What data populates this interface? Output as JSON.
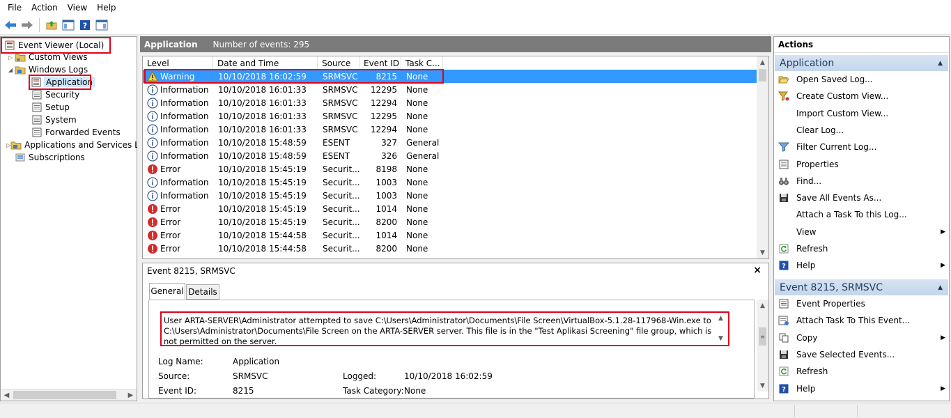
{
  "menu": [
    "File",
    "Action",
    "View",
    "Help"
  ],
  "toolbar": {
    "icons": [
      "back-arrow-icon",
      "forward-arrow-icon",
      "folder-up-icon",
      "show-hide-tree-icon",
      "help-icon",
      "show-action-pane-icon"
    ]
  },
  "tree": {
    "root": "Event Viewer (Local)",
    "custom_views": "Custom Views",
    "windows_logs": "Windows Logs",
    "logs": [
      "Application",
      "Security",
      "Setup",
      "System",
      "Forwarded Events"
    ],
    "apps_services": "Applications and Services Lo",
    "subscriptions": "Subscriptions"
  },
  "center": {
    "title": "Application",
    "count_text": "Number of events: 295"
  },
  "columns": [
    "Level",
    "Date and Time",
    "Source",
    "Event ID",
    "Task C..."
  ],
  "events": [
    {
      "level": "Warning",
      "icon": "warning-icon",
      "date": "10/10/2018 16:02:59",
      "source": "SRMSVC",
      "id": "8215",
      "task": "None"
    },
    {
      "level": "Information",
      "icon": "info-icon",
      "date": "10/10/2018 16:01:33",
      "source": "SRMSVC",
      "id": "12295",
      "task": "None"
    },
    {
      "level": "Information",
      "icon": "info-icon",
      "date": "10/10/2018 16:01:33",
      "source": "SRMSVC",
      "id": "12294",
      "task": "None"
    },
    {
      "level": "Information",
      "icon": "info-icon",
      "date": "10/10/2018 16:01:33",
      "source": "SRMSVC",
      "id": "12295",
      "task": "None"
    },
    {
      "level": "Information",
      "icon": "info-icon",
      "date": "10/10/2018 16:01:33",
      "source": "SRMSVC",
      "id": "12294",
      "task": "None"
    },
    {
      "level": "Information",
      "icon": "info-icon",
      "date": "10/10/2018 15:48:59",
      "source": "ESENT",
      "id": "327",
      "task": "General"
    },
    {
      "level": "Information",
      "icon": "info-icon",
      "date": "10/10/2018 15:48:59",
      "source": "ESENT",
      "id": "326",
      "task": "General"
    },
    {
      "level": "Error",
      "icon": "error-icon",
      "date": "10/10/2018 15:45:19",
      "source": "Securit...",
      "id": "8198",
      "task": "None"
    },
    {
      "level": "Information",
      "icon": "info-icon",
      "date": "10/10/2018 15:45:19",
      "source": "Securit...",
      "id": "1003",
      "task": "None"
    },
    {
      "level": "Information",
      "icon": "info-icon",
      "date": "10/10/2018 15:45:19",
      "source": "Securit...",
      "id": "1003",
      "task": "None"
    },
    {
      "level": "Error",
      "icon": "error-icon",
      "date": "10/10/2018 15:45:19",
      "source": "Securit...",
      "id": "1014",
      "task": "None"
    },
    {
      "level": "Error",
      "icon": "error-icon",
      "date": "10/10/2018 15:45:19",
      "source": "Securit...",
      "id": "8200",
      "task": "None"
    },
    {
      "level": "Error",
      "icon": "error-icon",
      "date": "10/10/2018 15:44:58",
      "source": "Securit...",
      "id": "1014",
      "task": "None"
    },
    {
      "level": "Error",
      "icon": "error-icon",
      "date": "10/10/2018 15:44:58",
      "source": "Securit...",
      "id": "8200",
      "task": "None"
    }
  ],
  "details": {
    "title": "Event 8215, SRMSVC",
    "close": "×",
    "tabs": [
      "General",
      "Details"
    ],
    "message": "User ARTA-SERVER\\Administrator attempted to save C:\\Users\\Administrator\\Documents\\File Screen\\VirtualBox-5.1.28-117968-Win.exe to C:\\Users\\Administrator\\Documents\\File Screen on the ARTA-SERVER server. This file is in the \"Test Aplikasi Screening\" file group, which is not permitted on the server.",
    "log_name_label": "Log Name:",
    "log_name": "Application",
    "source_label": "Source:",
    "source": "SRMSVC",
    "logged_label": "Logged:",
    "logged": "10/10/2018 16:02:59",
    "event_id_label": "Event ID:",
    "event_id": "8215",
    "task_category_label": "Task Category:",
    "task_category": "None"
  },
  "actions": {
    "title": "Actions",
    "section1": "Application",
    "items1": [
      {
        "label": "Open Saved Log...",
        "icon": "open-folder-icon"
      },
      {
        "label": "Create Custom View...",
        "icon": "filter-create-icon"
      },
      {
        "label": "Import Custom View...",
        "icon": ""
      },
      {
        "label": "Clear Log...",
        "icon": ""
      },
      {
        "label": "Filter Current Log...",
        "icon": "filter-icon"
      },
      {
        "label": "Properties",
        "icon": "properties-icon"
      },
      {
        "label": "Find...",
        "icon": "binoculars-icon"
      },
      {
        "label": "Save All Events As...",
        "icon": "save-icon"
      },
      {
        "label": "Attach a Task To this Log...",
        "icon": ""
      },
      {
        "label": "View",
        "icon": "",
        "submenu": true
      },
      {
        "label": "Refresh",
        "icon": "refresh-icon"
      },
      {
        "label": "Help",
        "icon": "help-icon",
        "submenu": true
      }
    ],
    "section2": "Event 8215, SRMSVC",
    "items2": [
      {
        "label": "Event Properties",
        "icon": "properties-icon"
      },
      {
        "label": "Attach Task To This Event...",
        "icon": "task-icon"
      },
      {
        "label": "Copy",
        "icon": "copy-icon",
        "submenu": true
      },
      {
        "label": "Save Selected Events...",
        "icon": "save-icon"
      },
      {
        "label": "Refresh",
        "icon": "refresh-icon"
      },
      {
        "label": "Help",
        "icon": "help-icon",
        "submenu": true
      }
    ]
  }
}
